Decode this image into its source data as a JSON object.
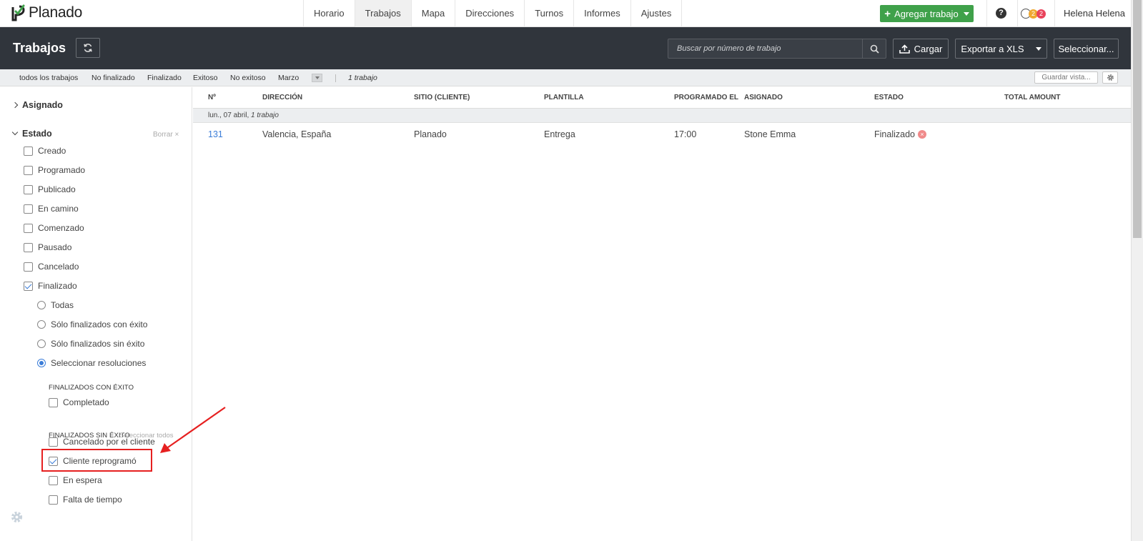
{
  "app": {
    "logo_text": "Planado",
    "brand_color": "#3fa14a"
  },
  "topnav": {
    "tabs": [
      {
        "label": "Horario",
        "active": false
      },
      {
        "label": "Trabajos",
        "active": true
      },
      {
        "label": "Mapa",
        "active": false
      },
      {
        "label": "Direcciones",
        "active": false
      },
      {
        "label": "Turnos",
        "active": false
      },
      {
        "label": "Informes",
        "active": false
      },
      {
        "label": "Ajustes",
        "active": false
      }
    ],
    "add_button": "Agregar trabajo",
    "help": "?",
    "notif_badge_1": "2",
    "notif_badge_2": "2",
    "user": "Helena Helena"
  },
  "header": {
    "title": "Trabajos",
    "search_placeholder": "Buscar por número de trabajo",
    "upload_label": "Cargar",
    "export_label": "Exportar a XLS",
    "select_label": "Seleccionar..."
  },
  "filterbar": {
    "tabs": [
      "todos los trabajos",
      "No finalizado",
      "Finalizado",
      "Exitoso",
      "No exitoso",
      "Marzo"
    ],
    "count": "1 trabajo",
    "save_view": "Guardar vista..."
  },
  "sidebar": {
    "assigned": "Asignado",
    "status": "Estado",
    "clear": "Borrar ×",
    "statuses": [
      {
        "label": "Creado",
        "checked": false
      },
      {
        "label": "Programado",
        "checked": false
      },
      {
        "label": "Publicado",
        "checked": false
      },
      {
        "label": "En camino",
        "checked": false
      },
      {
        "label": "Comenzado",
        "checked": false
      },
      {
        "label": "Pausado",
        "checked": false
      },
      {
        "label": "Cancelado",
        "checked": false
      },
      {
        "label": "Finalizado",
        "checked": true
      }
    ],
    "radios": [
      {
        "label": "Todas",
        "checked": false
      },
      {
        "label": "Sólo finalizados con éxito",
        "checked": false
      },
      {
        "label": "Sólo finalizados sin éxito",
        "checked": false
      },
      {
        "label": "Seleccionar resoluciones",
        "checked": true
      }
    ],
    "success_heading": "Finalizados con éxito",
    "success_items": [
      {
        "label": "Completado",
        "checked": false
      }
    ],
    "fail_heading": "Finalizados sin éxito",
    "select_all": "Seleccionar todos",
    "fail_items": [
      {
        "label": "Cancelado por el cliente",
        "checked": false
      },
      {
        "label": "Cliente reprogramó",
        "checked": true
      },
      {
        "label": "En espera",
        "checked": false
      },
      {
        "label": "Falta de tiempo",
        "checked": false
      }
    ]
  },
  "table": {
    "columns": [
      "Nº",
      "Dirección",
      "Sitio (cliente)",
      "Plantilla",
      "Programado el",
      "Asignado",
      "Estado",
      "Total amount"
    ],
    "group_date": "lun., 07 abril,",
    "group_count": "1 trabajo",
    "rows": [
      {
        "num": "131",
        "address": "Valencia, España",
        "site": "Planado",
        "template": "Entrega",
        "scheduled": "17:00",
        "assignee": "Stone Emma",
        "status": "Finalizado",
        "total": ""
      }
    ]
  }
}
